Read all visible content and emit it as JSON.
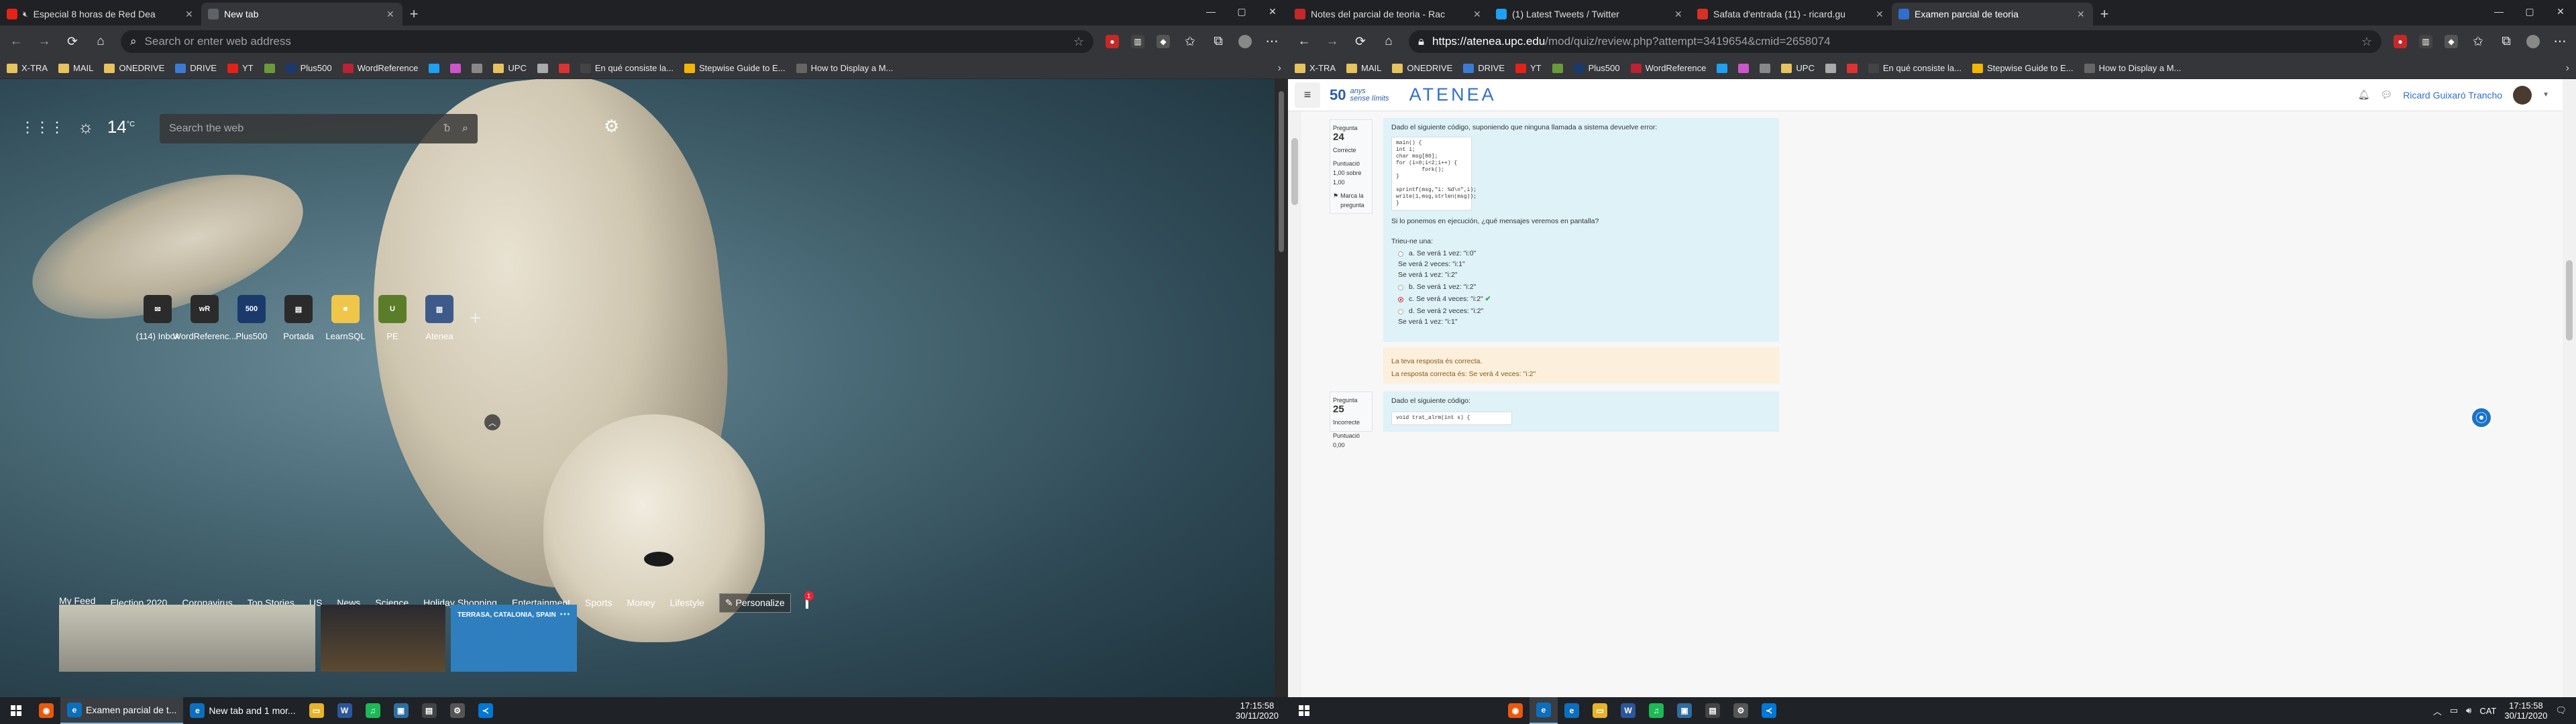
{
  "left": {
    "tabs": [
      {
        "title": "Especial 8 horas de Red Dea",
        "icon": "youtube-icon",
        "color": "#e62117",
        "muted": true
      },
      {
        "title": "New tab",
        "icon": "newtab-icon",
        "color": "#5f6368",
        "active": true
      }
    ],
    "address_placeholder": "Search or enter web address",
    "bookmarks": [
      "X-TRA",
      "MAIL",
      "ONEDRIVE",
      "DRIVE",
      "YT",
      "",
      "Plus500",
      "WordReference",
      "",
      "",
      "",
      "UPC",
      "",
      "",
      "En qué consiste la...",
      "Stepwise Guide to E...",
      "How to Display a M..."
    ],
    "weather": {
      "temp": "14",
      "unit": "°C"
    },
    "search_placeholder": "Search the web",
    "quick_links": [
      {
        "label": "(114) Inbox",
        "glyph": "✉",
        "color": "#2b2b2b"
      },
      {
        "label": "WordReferenc...",
        "glyph": "wR",
        "color": "#2b2b2b"
      },
      {
        "label": "Plus500",
        "glyph": "500",
        "color": "#1b3a6b"
      },
      {
        "label": "Portada",
        "glyph": "▤",
        "color": "#2b2b2b"
      },
      {
        "label": "LearnSQL",
        "glyph": "■",
        "color": "#f0c64a"
      },
      {
        "label": "PE",
        "glyph": "U",
        "color": "#5b7d2a"
      },
      {
        "label": "Atenea",
        "glyph": "▥",
        "color": "#3e5a8a"
      }
    ],
    "feed_tabs": [
      "My Feed",
      "Election 2020",
      "Coronavirus",
      "Top Stories",
      "US",
      "News",
      "Science",
      "Holiday Shopping",
      "Entertainment",
      "Sports",
      "Money",
      "Lifestyle"
    ],
    "personalize": "Personalize",
    "notif_count": "1",
    "card3_location": "TERRASA, CATALONIA, SPAIN",
    "taskbar_apps": [
      {
        "label": "",
        "glyph": "◉",
        "color": "#e8590c"
      },
      {
        "label": "Examen parcial de t...",
        "glyph": "e",
        "color": "#0c6fbd",
        "active": true
      },
      {
        "label": "New tab and 1 mor...",
        "glyph": "e",
        "color": "#0c6fbd"
      },
      {
        "label": "",
        "glyph": "▭",
        "color": "#e6b32a"
      },
      {
        "label": "",
        "glyph": "W",
        "color": "#2b579a"
      },
      {
        "label": "",
        "glyph": "♫",
        "color": "#1db954"
      },
      {
        "label": "",
        "glyph": "▣",
        "color": "#2d6ea0"
      },
      {
        "label": "",
        "glyph": "▤",
        "color": "#444"
      },
      {
        "label": "",
        "glyph": "⚙",
        "color": "#555"
      },
      {
        "label": "",
        "glyph": "≺",
        "color": "#0078d4"
      }
    ],
    "clock_time": "17:15:58",
    "clock_date": "30/11/2020"
  },
  "right": {
    "tabs": [
      {
        "title": "Notes del parcial de teoria - Rac",
        "icon": "pdf-icon",
        "color": "#c62828"
      },
      {
        "title": "(1) Latest Tweets / Twitter",
        "icon": "twitter-icon",
        "color": "#1da1f2"
      },
      {
        "title": "Safata d'entrada (11) - ricard.gu",
        "icon": "gmail-icon",
        "color": "#d93025"
      },
      {
        "title": "Examen parcial de teoria",
        "icon": "atenea-icon",
        "color": "#2f6fcf",
        "active": true
      }
    ],
    "url_host": "https://atenea.upc.edu",
    "url_path": "/mod/quiz/review.php?attempt=3419654&cmid=2658074",
    "bookmarks": [
      "X-TRA",
      "MAIL",
      "ONEDRIVE",
      "DRIVE",
      "YT",
      "",
      "Plus500",
      "WordReference",
      "",
      "",
      "",
      "UPC",
      "",
      "",
      "En qué consiste la...",
      "Stepwise Guide to E...",
      "How to Display a M..."
    ],
    "logo_50": "50",
    "logo_anys": "anys",
    "logo_sense": "sense límits",
    "site_name": "ATENEA",
    "user_name": "Ricard Guixaró Trancho",
    "q24": {
      "label": "Pregunta",
      "number": "24",
      "state": "Correcte",
      "score": "Puntuació 1,00 sobre 1,00",
      "flag": "Marca la pregunta",
      "text": "Dado el siguiente código, suponiendo que ninguna llamada a sistema devuelve error:",
      "code": [
        "main() {",
        "int i;",
        "char msg[80];",
        "for (i=0;i<2;i++) {",
        "        fork();",
        "}",
        "",
        "sprintf(msg,\"i: %d\\n\",i);",
        "write(1,msg,strlen(msg));",
        "}"
      ],
      "prompt": "Si lo ponemos en ejecución, ¿qué mensajes veremos en pantalla?",
      "choose": "Trieu-ne una:",
      "answers": [
        {
          "letter": "a.",
          "lines": [
            "Se verá 1 vez: \"i:0\"",
            "Se verá 2 veces: \"i:1\"",
            "Se verá 1 vez: \"i:2\""
          ]
        },
        {
          "letter": "b.",
          "lines": [
            "Se verá 1 vez: \"i:2\""
          ]
        },
        {
          "letter": "c.",
          "lines": [
            "Se verá 4 veces: \"i:2\""
          ],
          "selected": true,
          "correct": true
        },
        {
          "letter": "d.",
          "lines": [
            "Se verá 2 veces: \"i:2\"",
            "Se verá 1 vez: \"i:1\""
          ]
        }
      ],
      "feedback1": "La teva resposta és correcta.",
      "feedback2": "La resposta correcta és: Se verá 4 veces: \"i:2\""
    },
    "q25": {
      "label": "Pregunta",
      "number": "25",
      "state": "Incorrecte",
      "score": "Puntuació 0,00",
      "text": "Dado el siguiente código:",
      "code_first": "void trat_alrm(int s) {"
    },
    "tray_lang": "CAT",
    "clock_time": "17:15:58",
    "clock_date": "30/11/2020"
  }
}
